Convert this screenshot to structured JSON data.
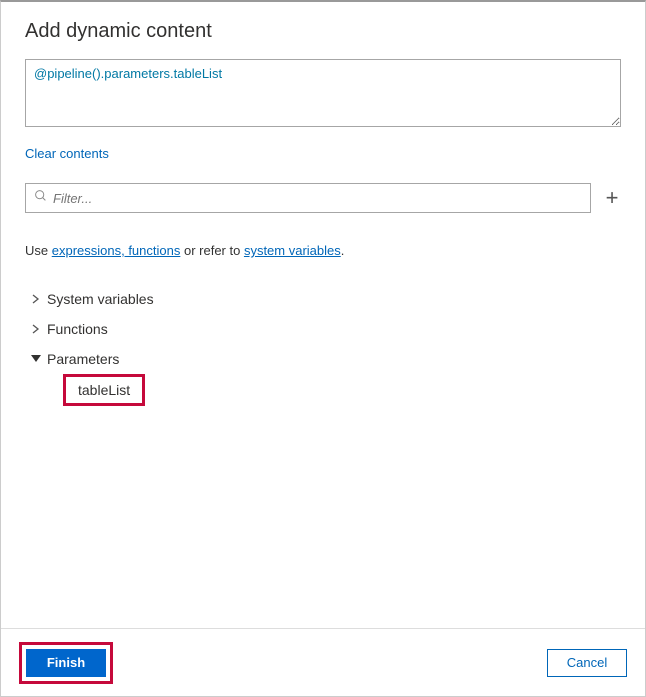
{
  "title": "Add dynamic content",
  "expression": "@pipeline().parameters.tableList",
  "clear_label": "Clear contents",
  "filter_placeholder": "Filter...",
  "help": {
    "prefix": "Use ",
    "link1": "expressions, functions",
    "mid": " or refer to ",
    "link2": "system variables",
    "suffix": "."
  },
  "tree": {
    "system_variables": "System variables",
    "functions": "Functions",
    "parameters": "Parameters",
    "param_item": "tableList"
  },
  "footer": {
    "finish": "Finish",
    "cancel": "Cancel"
  }
}
